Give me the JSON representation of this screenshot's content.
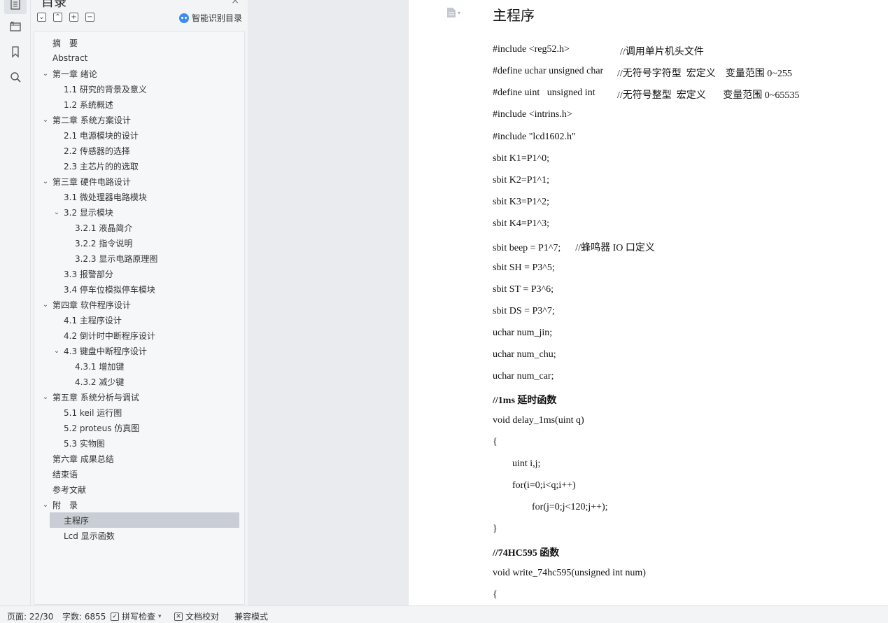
{
  "toc": {
    "title": "目录",
    "close_glyph": "×",
    "tools": [
      "⌄",
      "⌃",
      "+",
      "−"
    ],
    "smart_label": "智能识别目录",
    "items": [
      {
        "label": "摘　要",
        "level": 1,
        "caret": ""
      },
      {
        "label": "Abstract",
        "level": 1,
        "caret": ""
      },
      {
        "label": "第一章 绪论",
        "level": 1,
        "caret": "⌄"
      },
      {
        "label": "1.1 研究的背景及意义",
        "level": 2,
        "caret": ""
      },
      {
        "label": "1.2 系统概述",
        "level": 2,
        "caret": ""
      },
      {
        "label": "第二章 系统方案设计",
        "level": 1,
        "caret": "⌄"
      },
      {
        "label": "2.1 电源模块的设计",
        "level": 2,
        "caret": ""
      },
      {
        "label": "2.2 传感器的选择",
        "level": 2,
        "caret": ""
      },
      {
        "label": "2.3 主芯片的的选取",
        "level": 2,
        "caret": ""
      },
      {
        "label": "第三章 硬件电路设计",
        "level": 1,
        "caret": "⌄"
      },
      {
        "label": "3.1 微处理器电路模块",
        "level": 2,
        "caret": ""
      },
      {
        "label": "3.2 显示模块",
        "level": 2,
        "caret": "⌄"
      },
      {
        "label": "3.2.1 液晶简介",
        "level": 3,
        "caret": ""
      },
      {
        "label": "3.2.2 指令说明",
        "level": 3,
        "caret": ""
      },
      {
        "label": "3.2.3 显示电路原理图",
        "level": 3,
        "caret": ""
      },
      {
        "label": "3.3 报警部分",
        "level": 2,
        "caret": ""
      },
      {
        "label": "3.4 停车位模拟停车模块",
        "level": 2,
        "caret": ""
      },
      {
        "label": "第四章 软件程序设计",
        "level": 1,
        "caret": "⌄"
      },
      {
        "label": "4.1 主程序设计",
        "level": 2,
        "caret": ""
      },
      {
        "label": "4.2 倒计时中断程序设计",
        "level": 2,
        "caret": ""
      },
      {
        "label": "4.3 键盘中断程序设计",
        "level": 2,
        "caret": "⌄"
      },
      {
        "label": "4.3.1 增加键",
        "level": 3,
        "caret": ""
      },
      {
        "label": "4.3.2 减少键",
        "level": 3,
        "caret": ""
      },
      {
        "label": "第五章 系统分析与调试",
        "level": 1,
        "caret": "⌄"
      },
      {
        "label": "5.1 keil 运行图",
        "level": 2,
        "caret": ""
      },
      {
        "label": "5.2 proteus 仿真图",
        "level": 2,
        "caret": ""
      },
      {
        "label": "5.3 实物图",
        "level": 2,
        "caret": ""
      },
      {
        "label": "第六章 成果总结",
        "level": 1,
        "caret": ""
      },
      {
        "label": "结束语",
        "level": 1,
        "caret": ""
      },
      {
        "label": "参考文献",
        "level": 1,
        "caret": ""
      },
      {
        "label": "附　录",
        "level": 1,
        "caret": "⌄"
      },
      {
        "label": "主程序",
        "level": 2,
        "caret": "",
        "selected": true
      },
      {
        "label": "Lcd 显示函数",
        "level": 2,
        "caret": ""
      }
    ]
  },
  "document": {
    "heading": "主程序",
    "lines": [
      {
        "code": "#include <reg52.h>",
        "comment": "//调用单片机头文件",
        "indent": 0,
        "bold": false
      },
      {
        "code": "#define uchar unsigned char",
        "comment": "//无符号字符型  宏定义    变量范围 0~255",
        "indent": 0,
        "bold": false
      },
      {
        "code": "#define uint   unsigned int",
        "comment": "//无符号整型  宏定义       变量范围 0~65535",
        "indent": 0,
        "bold": false
      },
      {
        "code": "#include <intrins.h>",
        "comment": "",
        "indent": 0,
        "bold": false
      },
      {
        "code": "#include \"lcd1602.h\"",
        "comment": "",
        "indent": 0,
        "bold": false
      },
      {
        "code": "sbit K1=P1^0;",
        "comment": "",
        "indent": 0,
        "bold": false
      },
      {
        "code": "sbit K2=P1^1;",
        "comment": "",
        "indent": 0,
        "bold": false
      },
      {
        "code": "sbit K3=P1^2;",
        "comment": "",
        "indent": 0,
        "bold": false
      },
      {
        "code": "sbit K4=P1^3;",
        "comment": "",
        "indent": 0,
        "bold": false
      },
      {
        "code": "sbit beep = P1^7;      //蜂鸣器 IO 口定义",
        "comment": "",
        "indent": 0,
        "bold": false
      },
      {
        "code": "sbit SH = P3^5;",
        "comment": "",
        "indent": 0,
        "bold": false
      },
      {
        "code": "sbit ST = P3^6;",
        "comment": "",
        "indent": 0,
        "bold": false
      },
      {
        "code": "sbit DS = P3^7;",
        "comment": "",
        "indent": 0,
        "bold": false
      },
      {
        "code": "uchar num_jin;",
        "comment": "",
        "indent": 0,
        "bold": false
      },
      {
        "code": "uchar num_chu;",
        "comment": "",
        "indent": 0,
        "bold": false
      },
      {
        "code": "uchar num_car;",
        "comment": "",
        "indent": 0,
        "bold": false
      },
      {
        "code": "//1ms 延时函数",
        "comment": "",
        "indent": 0,
        "bold": true
      },
      {
        "code": "void delay_1ms(uint q)",
        "comment": "",
        "indent": 0,
        "bold": false
      },
      {
        "code": "{",
        "comment": "",
        "indent": 0,
        "bold": false
      },
      {
        "code": "uint i,j;",
        "comment": "",
        "indent": 1,
        "bold": false
      },
      {
        "code": "for(i=0;i<q;i++)",
        "comment": "",
        "indent": 1,
        "bold": false
      },
      {
        "code": "for(j=0;j<120;j++);",
        "comment": "",
        "indent": 2,
        "bold": false
      },
      {
        "code": "}",
        "comment": "",
        "indent": 0,
        "bold": false
      },
      {
        "code": "//74HC595 函数",
        "comment": "",
        "indent": 0,
        "bold": true
      },
      {
        "code": "void write_74hc595(unsigned int num)",
        "comment": "",
        "indent": 0,
        "bold": false
      },
      {
        "code": "{",
        "comment": "",
        "indent": 0,
        "bold": false
      }
    ]
  },
  "status": {
    "page": "页面: 22/30",
    "words": "字数: 6855",
    "spell": "拼写检查",
    "spell_arrow": "▾",
    "proof": "文档校对",
    "compat": "兼容模式"
  },
  "icons": {
    "rail": [
      "toc-icon",
      "nav-panel-icon",
      "bookmark-icon",
      "search-icon"
    ],
    "doc": "document-icon"
  }
}
